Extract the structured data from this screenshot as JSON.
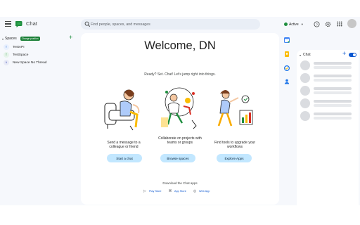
{
  "app": {
    "title": "Chat"
  },
  "search": {
    "placeholder": "Find people, spaces, and messages"
  },
  "status": {
    "label": "Active"
  },
  "sidebar": {
    "section_label": "Spaces",
    "badge": "Change position",
    "items": [
      {
        "initial": "T",
        "label": "TestAPI",
        "bg": "#e8f0fe"
      },
      {
        "initial": "T",
        "label": "TestSpace",
        "bg": "#e6f4ea"
      },
      {
        "initial": "N",
        "label": "New Space No Thread",
        "bg": "#e8eaf6"
      }
    ]
  },
  "main": {
    "heading": "Welcome, DN",
    "tagline": "Ready? Set. Chat! Let's jump right into things.",
    "columns": [
      {
        "text": "Send a message to a colleague or friend",
        "button": "Start a chat"
      },
      {
        "text": "Collaborate on projects with teams or groups",
        "button": "Browse spaces"
      },
      {
        "text": "Find tools to upgrade your workflows",
        "button": "Explore Apps"
      }
    ],
    "download_label": "Download the Chat apps",
    "stores": [
      "Play Store",
      "App Store",
      "Web App"
    ]
  },
  "right_panel": {
    "title": "Chat"
  },
  "colors": {
    "accent": "#0b57d0",
    "brand_green": "#1e8e3e",
    "pill_bg": "#c2e7ff",
    "app_bg": "#f6f8fc"
  },
  "icons": [
    "menu-icon",
    "chat-logo",
    "search-icon",
    "help-icon",
    "settings-icon",
    "apps-grid-icon",
    "avatar",
    "calendar-icon",
    "keep-icon",
    "tasks-icon",
    "contacts-icon"
  ]
}
